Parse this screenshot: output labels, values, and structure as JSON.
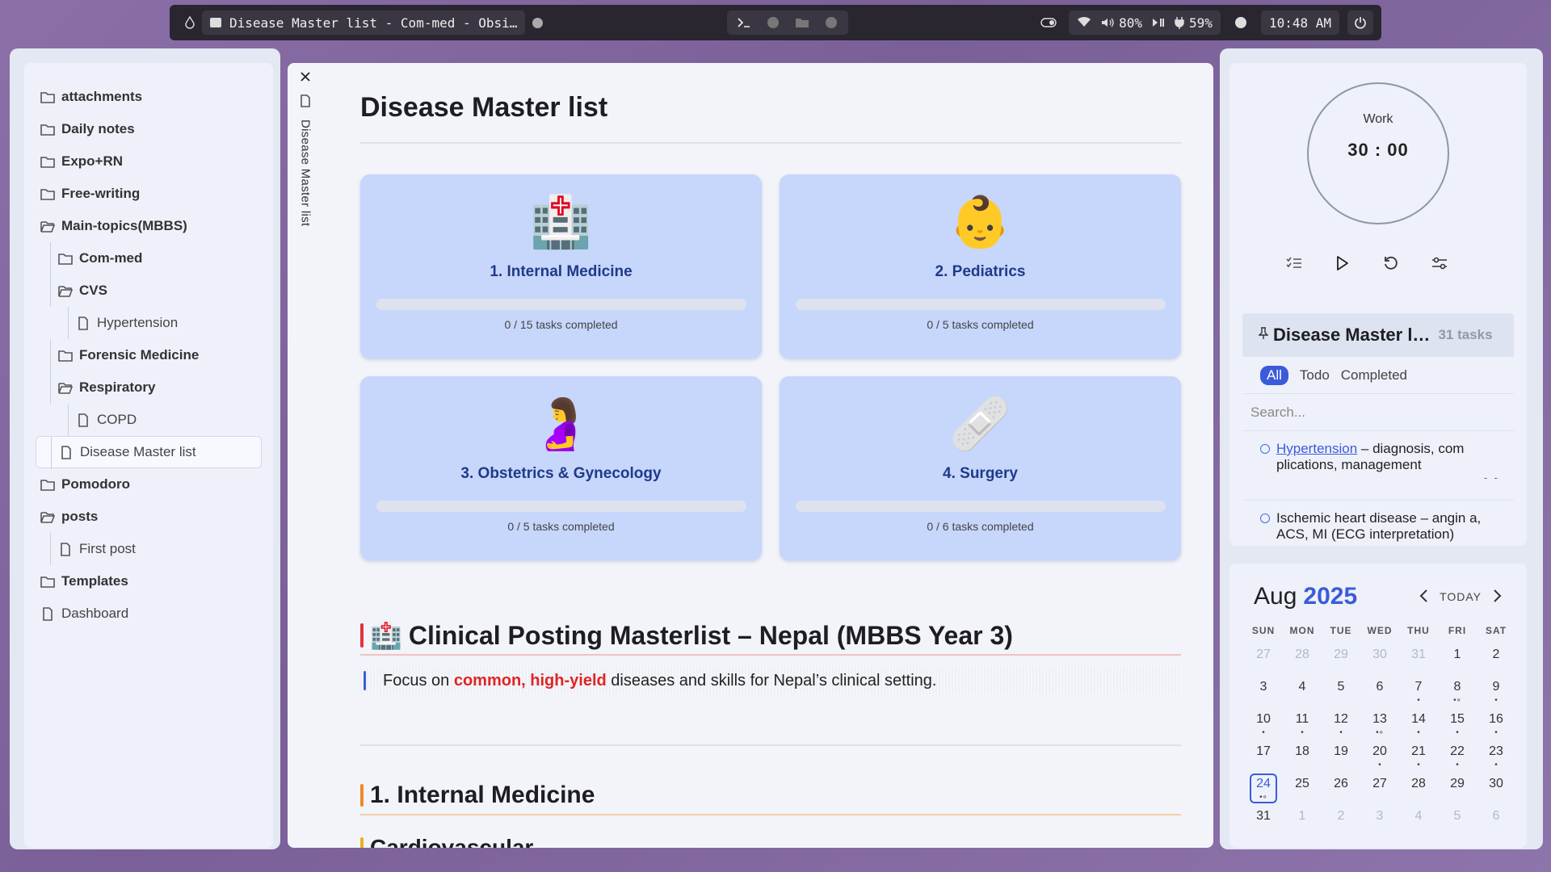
{
  "topbar": {
    "window_title": "Disease Master list - Com-med - Obsi…",
    "volume": "80%",
    "battery": "59%",
    "time": "10:48 AM"
  },
  "sidebar": {
    "items": [
      {
        "label": "attachments",
        "type": "folder",
        "depth": 0,
        "open": false
      },
      {
        "label": "Daily notes",
        "type": "folder",
        "depth": 0,
        "open": false
      },
      {
        "label": "Expo+RN",
        "type": "folder",
        "depth": 0,
        "open": false
      },
      {
        "label": "Free-writing",
        "type": "folder",
        "depth": 0,
        "open": false
      },
      {
        "label": "Main-topics(MBBS)",
        "type": "folder",
        "depth": 0,
        "open": true
      },
      {
        "label": "Com-med",
        "type": "folder",
        "depth": 1,
        "open": false
      },
      {
        "label": "CVS",
        "type": "folder",
        "depth": 1,
        "open": true
      },
      {
        "label": "Hypertension",
        "type": "file",
        "depth": 2
      },
      {
        "label": "Forensic Medicine",
        "type": "folder",
        "depth": 1,
        "open": false
      },
      {
        "label": "Respiratory",
        "type": "folder",
        "depth": 1,
        "open": true
      },
      {
        "label": "COPD",
        "type": "file",
        "depth": 2
      },
      {
        "label": "Disease Master list",
        "type": "file",
        "depth": 1,
        "active": true
      },
      {
        "label": "Pomodoro",
        "type": "folder",
        "depth": 0,
        "open": false
      },
      {
        "label": "posts",
        "type": "folder",
        "depth": 0,
        "open": true
      },
      {
        "label": "First post",
        "type": "file",
        "depth": 1
      },
      {
        "label": "Templates",
        "type": "folder",
        "depth": 0,
        "open": false
      },
      {
        "label": "Dashboard",
        "type": "file",
        "depth": 0
      }
    ]
  },
  "main": {
    "tab_label": "Disease Master list",
    "title": "Disease Master list",
    "cards": [
      {
        "emoji": "🏥",
        "title": "1. Internal Medicine",
        "progress": "0 / 15 tasks completed",
        "fraction": 0
      },
      {
        "emoji": "👶",
        "title": "2. Pediatrics",
        "progress": "0 / 5 tasks completed",
        "fraction": 0
      },
      {
        "emoji": "🤰",
        "title": "3. Obstetrics & Gynecology",
        "progress": "0 / 5 tasks completed",
        "fraction": 0
      },
      {
        "emoji": "🩹",
        "title": "4. Surgery",
        "progress": "0 / 6 tasks completed",
        "fraction": 0
      }
    ],
    "h2_emoji": "🏥",
    "h2": "Clinical Posting Masterlist – Nepal (MBBS Year 3)",
    "callout_pre": "Focus on ",
    "callout_highlight": "common, high-yield",
    "callout_post": " diseases and skills for Nepal’s clinical setting.",
    "h3": "1. Internal Medicine",
    "h4": "Cardiovascular"
  },
  "pomodoro": {
    "mode": "Work",
    "time": "30 : 00"
  },
  "tasks": {
    "title": "Disease Master l…",
    "count": "31 tasks",
    "filters": [
      "All",
      "Todo",
      "Completed"
    ],
    "active_filter": "All",
    "search_placeholder": "Search...",
    "items": [
      {
        "link": "Hypertension",
        "text": " – diagnosis, com plications, management",
        "meta": "- -"
      },
      {
        "link": "",
        "text": "Ischemic heart disease – angin a, ACS, MI (ECG interpretation)",
        "meta": ""
      }
    ]
  },
  "calendar": {
    "month": "Aug",
    "year": "2025",
    "today_label": "TODAY",
    "dow": [
      "SUN",
      "MON",
      "TUE",
      "WED",
      "THU",
      "FRI",
      "SAT"
    ],
    "days": [
      {
        "d": "27",
        "m": true,
        "dots": ""
      },
      {
        "d": "28",
        "m": true,
        "dots": ""
      },
      {
        "d": "29",
        "m": true,
        "dots": ""
      },
      {
        "d": "30",
        "m": true,
        "dots": ""
      },
      {
        "d": "31",
        "m": true,
        "dots": ""
      },
      {
        "d": "1",
        "dots": ""
      },
      {
        "d": "2",
        "dots": ""
      },
      {
        "d": "3",
        "dots": ""
      },
      {
        "d": "4",
        "dots": ""
      },
      {
        "d": "5",
        "dots": ""
      },
      {
        "d": "6",
        "dots": ""
      },
      {
        "d": "7",
        "dots": "•"
      },
      {
        "d": "8",
        "dots": "•∘"
      },
      {
        "d": "9",
        "dots": "•"
      },
      {
        "d": "10",
        "dots": "•"
      },
      {
        "d": "11",
        "dots": "•"
      },
      {
        "d": "12",
        "dots": "•"
      },
      {
        "d": "13",
        "dots": "•∘"
      },
      {
        "d": "14",
        "dots": "•"
      },
      {
        "d": "15",
        "dots": "•"
      },
      {
        "d": "16",
        "dots": "•"
      },
      {
        "d": "17",
        "dots": ""
      },
      {
        "d": "18",
        "dots": ""
      },
      {
        "d": "19",
        "dots": ""
      },
      {
        "d": "20",
        "dots": "•"
      },
      {
        "d": "21",
        "dots": "•"
      },
      {
        "d": "22",
        "dots": "•"
      },
      {
        "d": "23",
        "dots": "•"
      },
      {
        "d": "24",
        "today": true,
        "dots": "•∘"
      },
      {
        "d": "25",
        "dots": ""
      },
      {
        "d": "26",
        "dots": ""
      },
      {
        "d": "27",
        "dots": ""
      },
      {
        "d": "28",
        "dots": ""
      },
      {
        "d": "29",
        "dots": ""
      },
      {
        "d": "30",
        "dots": ""
      },
      {
        "d": "31",
        "dots": ""
      },
      {
        "d": "1",
        "m": true,
        "dots": ""
      },
      {
        "d": "2",
        "m": true,
        "dots": ""
      },
      {
        "d": "3",
        "m": true,
        "dots": ""
      },
      {
        "d": "4",
        "m": true,
        "dots": ""
      },
      {
        "d": "5",
        "m": true,
        "dots": ""
      },
      {
        "d": "6",
        "m": true,
        "dots": ""
      }
    ]
  },
  "colors": {
    "accent": "#3b5bdb",
    "card_bg": "#c7d6fb",
    "highlight_red": "#e02424"
  }
}
